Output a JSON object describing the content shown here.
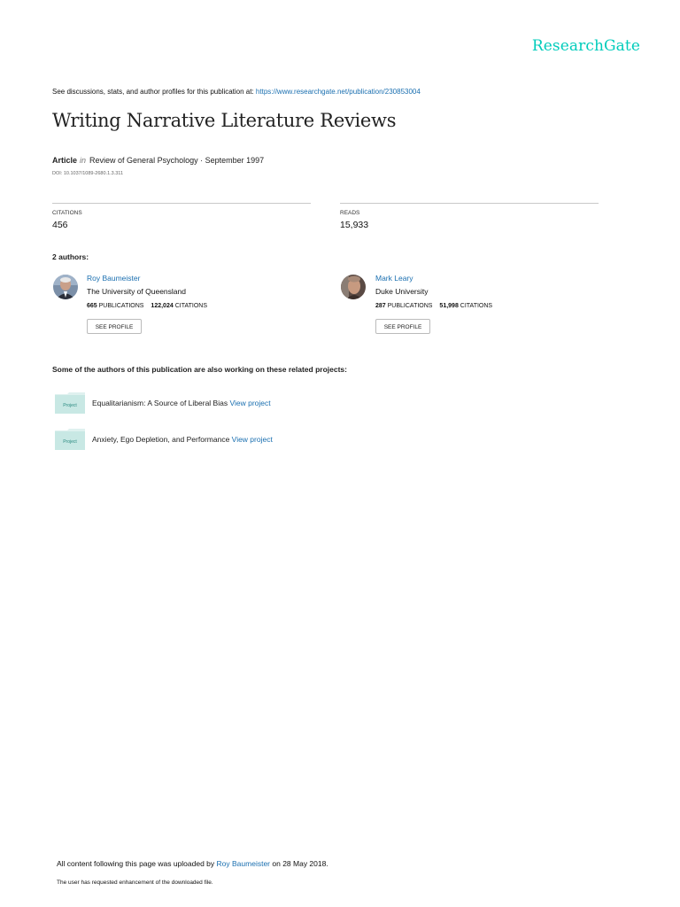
{
  "header": {
    "logo_text": "ResearchGate",
    "logo_color": "#00ccbb",
    "discussion_note": "See discussions, stats, and author profiles for this publication at:",
    "publication_url": "https://www.researchgate.net/publication/230853004"
  },
  "publication": {
    "title": "Writing Narrative Literature Reviews",
    "type": "Article",
    "in_word": "in",
    "journal_and_date": "Review of General Psychology · September 1997",
    "doi": "DOI: 10.1037/1089-2680.1.3.311"
  },
  "stats": {
    "citations_label": "CITATIONS",
    "citations_value": "456",
    "reads_label": "READS",
    "reads_value": "15,933"
  },
  "authors": {
    "heading": "2 authors:",
    "list": [
      {
        "name": "Roy Baumeister",
        "institution": "The University of Queensland",
        "publications_count": "665",
        "publications_label": "PUBLICATIONS",
        "citations_count": "122,024",
        "citations_label": "CITATIONS",
        "profile_button": "SEE PROFILE"
      },
      {
        "name": "Mark Leary",
        "institution": "Duke University",
        "publications_count": "287",
        "publications_label": "PUBLICATIONS",
        "citations_count": "51,998",
        "citations_label": "CITATIONS",
        "profile_button": "SEE PROFILE"
      }
    ]
  },
  "related": {
    "heading": "Some of the authors of this publication are also working on these related projects:",
    "projects": [
      {
        "badge": "Project",
        "title": "Equalitarianism: A Source of Liberal Bias",
        "link": "View project"
      },
      {
        "badge": "Project",
        "title": "Anxiety, Ego Depletion, and Performance",
        "link": "View project"
      }
    ]
  },
  "footer": {
    "upload_prefix": "All content following this page was uploaded by",
    "uploader": "Roy Baumeister",
    "upload_suffix": "on 28 May 2018.",
    "note": "The user has requested enhancement of the downloaded file."
  }
}
